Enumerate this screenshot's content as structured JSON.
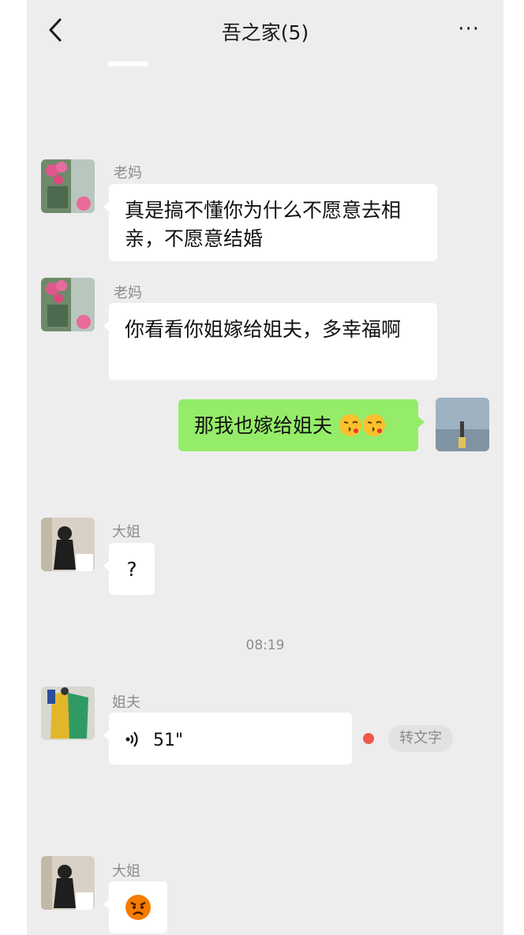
{
  "header": {
    "back_icon": "chevron-left-icon",
    "title": "吾之家(5)",
    "more_label": "···"
  },
  "messages": [
    {
      "sender": "老妈",
      "text": "真是搞不懂你为什么不愿意去相亲，不愿意结婚"
    },
    {
      "sender": "老妈",
      "text": "你看看你姐嫁给姐夫，多幸福啊"
    },
    {
      "sender": "me",
      "text": "那我也嫁给姐夫",
      "emoji": [
        "face-blowing-kiss",
        "face-blowing-kiss"
      ]
    },
    {
      "sender": "大姐",
      "text": "?"
    },
    {
      "timestamp": "08:19"
    },
    {
      "sender": "姐夫",
      "voice_duration": "51\"",
      "to_text_label": "转文字",
      "unread": true
    },
    {
      "sender": "大姐",
      "emoji": [
        "angry-face"
      ]
    }
  ],
  "colors": {
    "background": "#ededed",
    "bubble_in": "#ffffff",
    "bubble_out": "#95ec69",
    "unread_dot": "#f0584c"
  }
}
